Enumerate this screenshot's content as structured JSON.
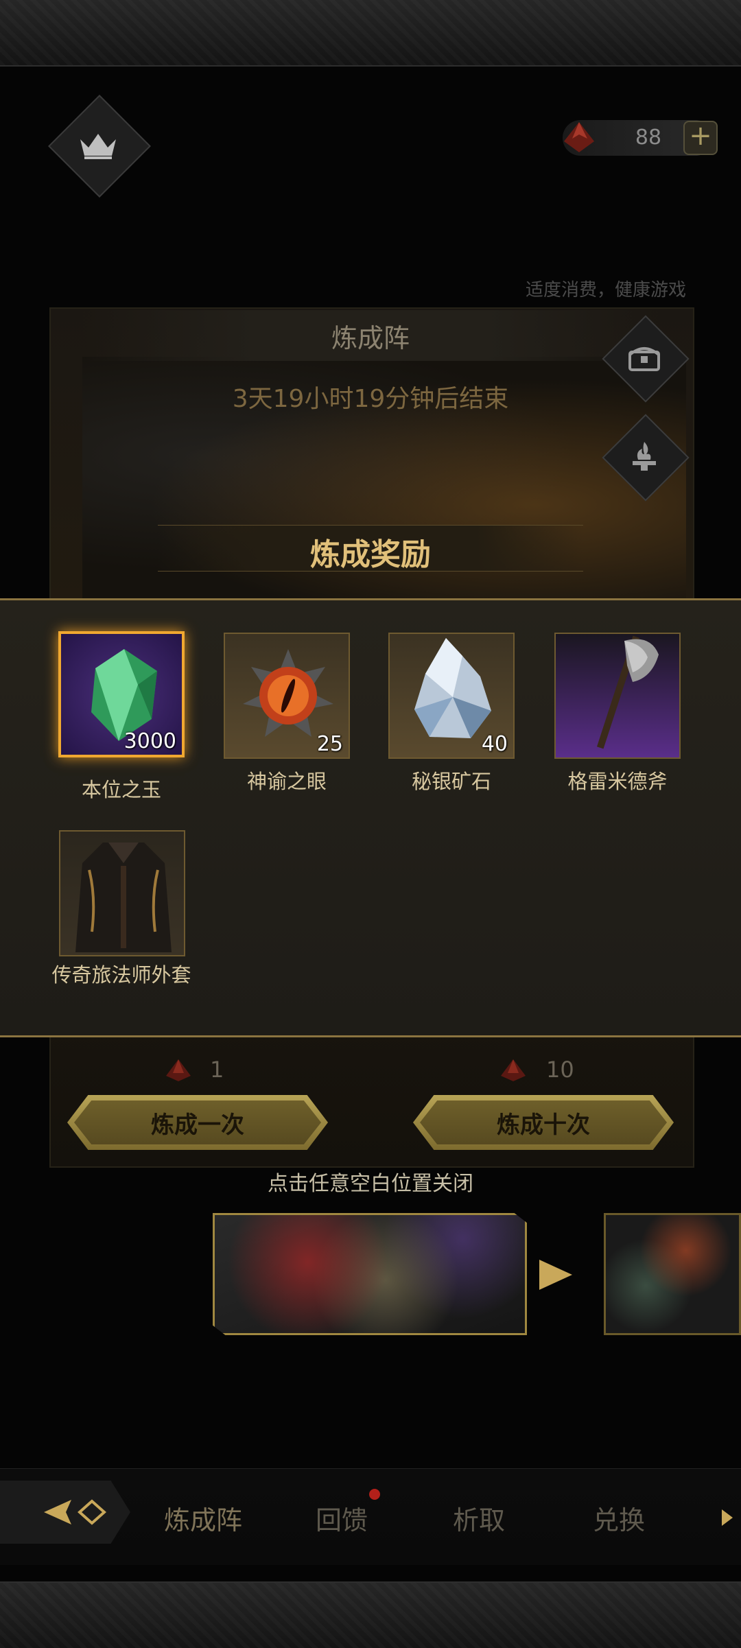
{
  "header": {
    "currency_value": "88",
    "plus_label": "+",
    "health_note": "适度消费，健康游戏"
  },
  "panel": {
    "title": "炼成阵",
    "countdown": "3天19小时19分钟后结束"
  },
  "reward": {
    "title": "炼成奖励",
    "items": [
      {
        "name": "本位之玉",
        "count": "3000",
        "rarity": "gold"
      },
      {
        "name": "神谕之眼",
        "count": "25",
        "rarity": "brown"
      },
      {
        "name": "秘银矿石",
        "count": "40",
        "rarity": "brown"
      },
      {
        "name": "格雷米德斧",
        "count": "",
        "rarity": "purple"
      },
      {
        "name": "传奇旅法师外套",
        "count": "",
        "rarity": "dark"
      }
    ]
  },
  "draw": {
    "single_cost": "1",
    "single_label": "炼成一次",
    "ten_cost": "10",
    "ten_label": "炼成十次"
  },
  "close_tip": "点击任意空白位置关闭",
  "tabs": [
    {
      "label": "炼成阵"
    },
    {
      "label": "回馈"
    },
    {
      "label": "析取"
    },
    {
      "label": "兑换"
    }
  ],
  "colors": {
    "accent_gold": "#e1c07a",
    "frame_gold": "#8b7440",
    "notification_red": "#b3201a"
  }
}
